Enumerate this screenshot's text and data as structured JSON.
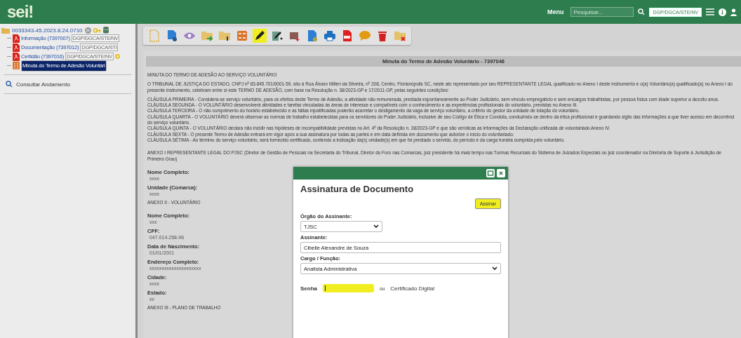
{
  "topbar": {
    "logo": "sei!",
    "menu": "Menu",
    "search": {
      "placeholder": "Pesquisar..."
    },
    "unit": "DGP/DGCA/STE/NV"
  },
  "tree": {
    "label": "0033343-45.2023.8.24.0710",
    "children": [
      {
        "kind": "pdf",
        "label": "Informação (7397007)",
        "badge": "DGP/DGCA/STE/NV",
        "selected": false
      },
      {
        "kind": "pdf",
        "label": "Documentação (7397012)",
        "badge": "DGP/DGCA/STI",
        "selected": false
      },
      {
        "kind": "pdf",
        "label": "Certidão (7397016)",
        "badge": "DGP/DGCA/STE/NV",
        "selected": false
      },
      {
        "kind": "form",
        "label": "Minuta do Termo de Adesão Voluntári",
        "selected": true
      }
    ]
  },
  "sidebar": {
    "items": [
      "Consultar Andamento"
    ]
  },
  "toolbar": [
    {
      "kind": "new",
      "highlighted": false
    },
    {
      "kind": "docgear",
      "highlighted": false
    },
    {
      "kind": "eye",
      "highlighted": false
    },
    {
      "kind": "folderarrow",
      "highlighted": false
    },
    {
      "kind": "folderinfo",
      "highlighted": false
    },
    {
      "kind": "form",
      "highlighted": false
    },
    {
      "kind": "pen",
      "highlighted": true
    },
    {
      "kind": "penuser",
      "highlighted": false
    },
    {
      "kind": "groupplus",
      "highlighted": false
    },
    {
      "kind": "docstar",
      "highlighted": false
    },
    {
      "kind": "printer",
      "highlighted": false
    },
    {
      "kind": "pdf",
      "highlighted": false
    },
    {
      "kind": "chat",
      "highlighted": false
    },
    {
      "kind": "trash",
      "highlighted": false
    },
    {
      "kind": "folderx",
      "highlighted": false
    }
  ],
  "document": {
    "title": "Minuta do Termo de Adesão Voluntário - 7397046",
    "blocks": [
      {
        "kind": "para",
        "lines": [
          "MINUTA DO TERMO DE ADESÃO AO SERVIÇO VOLUNTÁRIO"
        ]
      },
      {
        "kind": "para",
        "lines": [
          "O TRIBUNAL DE JUSTIÇA DO ESTADO, CNPJ nº 83.845.701/0001-59, sito à Rua Álvaro Millen da Silveira, nº 208, Centro, Florianópolis SC, neste ato representado por seu REPRESENTANTE LEGAL qualificado no Anexo I deste instrumento e o(a) Voluntário(a) qualificado(a) no Anexo I do",
          "presente instrumento, celebram entre si este TERMO DE ADESÃO, com base na Resolução n. 38/2023-GP e 17/2011-GP, pelas seguintes condições:"
        ]
      },
      {
        "kind": "para",
        "lines": [
          "CLÁUSULA PRIMEIRA - Considera-se serviço voluntário, para os efeitos deste Termo de Adesão, a atividade não remunerada, prestada espontaneamente ao Poder Judiciário, sem vínculo empregatício e sem encargos trabalhistas, por pessoa física com idade superior a dezoito anos.",
          "CLÁUSULA SEGUNDA - O VOLUNTÁRIO desenvolverá atividades e tarefas vinculadas às áreas de interesse e compatíveis com o conhecimento e as experiências profissionais do voluntário, previstas no Anexo III.",
          "CLÁUSULA TERCEIRA - O não cumprimento do horário estabelecido e as faltas injustificadas poderão acarretar o desligamento da vaga de serviço voluntário, a critério do gestor da unidade de lotação do voluntário.",
          "CLÁUSULA QUARTA - O VOLUNTÁRIO deverá observar as normas de trabalho estabelecidas para os servidores do Poder Judiciário, inclusive de seu Código de Ética e Conduta, conduzindo-se dentro da ética profissional e guardando sigilo das informações a que tiver acesso em decorrênci",
          "do serviço voluntário.",
          "CLÁUSULA QUINTA - O VOLUNTÁRIO declara não incidir nas hipóteses de incompatibilidade previstas no Art. 4º da Resolução n. 38/2023-GP e que são verídicas as informações da Declaração unificada de voluntariado Anexo IV.",
          "CLÁUSULA SEXTA - O presente Termo de Adesão entrará em vigor após a sua assinatura por todas as partes e em data definida em documento que autorize o início do voluntariado.",
          "CLÁUSULA SÉTIMA - Ao término do serviço voluntário, será fornecido certificado, contendo a indicação da(s) unidade(s) em que foi prestado o servido, do período e da carga horária cumprida pelo voluntário."
        ]
      },
      {
        "kind": "gap"
      },
      {
        "kind": "para",
        "lines": [
          "ANEXO I REPRESENTANTE LEGAL DO PJSC (Diretor de Gestão de Pessoas na Secretaria do Tribunal, Diretor do Foro nas Comarcas, juiz presidente há mais tempo nas Turmas Recursais do Sistema de Juizados Especiais ou juiz coordenador na Diretoria de Suporte à Jurisdição de",
          "Primeiro Grau)"
        ]
      },
      {
        "kind": "gap"
      },
      {
        "kind": "field",
        "label": "Nome Completo:",
        "value": "xxxx"
      },
      {
        "kind": "field",
        "label": "Unidade (Comarca):",
        "value": "xxxx"
      },
      {
        "kind": "para",
        "lines": [
          "ANEXO II - VOLUNTÁRIO"
        ]
      },
      {
        "kind": "gap"
      },
      {
        "kind": "field",
        "label": "Nome Completo:",
        "value": "xxx"
      },
      {
        "kind": "field",
        "label": "CPF:",
        "value": "047.014.258-96"
      },
      {
        "kind": "field",
        "label": "Data de Nascimento:",
        "value": "01/01/2001"
      },
      {
        "kind": "field",
        "label": "Endereço Completo:",
        "value": "xxxxxxxxxxxxxxxxxxxxx"
      },
      {
        "kind": "field",
        "label": "Cidade:",
        "value": "xxxx"
      },
      {
        "kind": "field",
        "label": "Estado:",
        "value": "xx"
      },
      {
        "kind": "para",
        "lines": [
          "ANEXO III - PLANO DE TRABALHO"
        ]
      }
    ]
  },
  "dialog": {
    "title": "Assinatura de Documento",
    "button": {
      "label": "Assinar",
      "highlighted": true
    },
    "orgao": {
      "label": "Órgão do Assinante:",
      "value": "TJSC"
    },
    "assinante": {
      "label": "Assinante:",
      "value": "Cibelle Alexandre de Souza"
    },
    "cargo": {
      "label": "Cargo / Função:",
      "value": "Analista Administrativa"
    },
    "senha": {
      "label": "Senha",
      "highlighted": true
    },
    "ou": "ou",
    "certificado": "Certificado Digital"
  }
}
